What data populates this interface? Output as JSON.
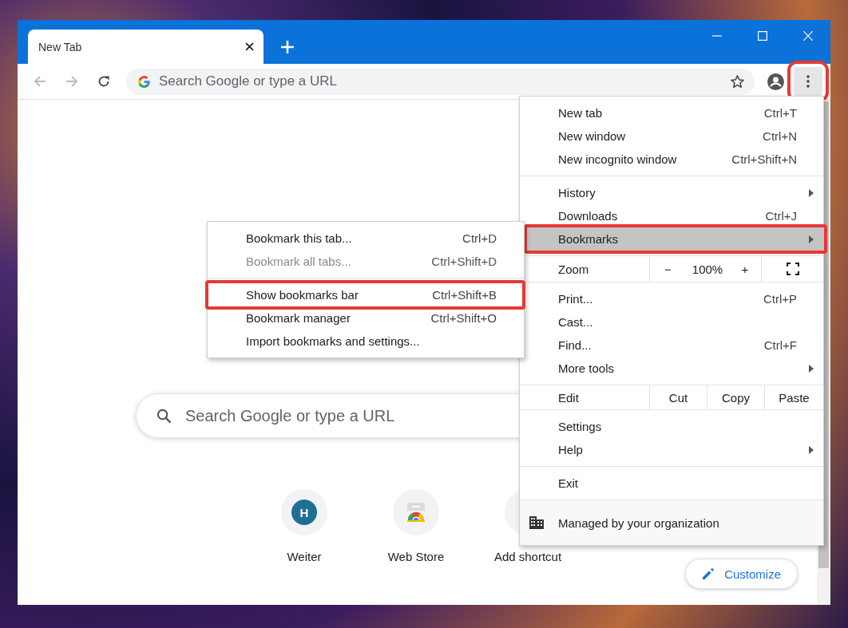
{
  "tabs": [
    {
      "title": "New Tab",
      "selected": true
    }
  ],
  "toolbar": {
    "omnibox": {
      "placeholder": "Search Google or type a URL"
    },
    "menu_button": {
      "highlighted": true
    }
  },
  "new_tab_page": {
    "search": {
      "placeholder": "Search Google or type a URL"
    },
    "shortcuts": [
      {
        "kind": "site",
        "label": "Weiter",
        "letter": "H"
      },
      {
        "kind": "store",
        "label": "Web Store"
      },
      {
        "kind": "add",
        "label": "Add shortcut"
      }
    ],
    "customize_button": "Customize"
  },
  "menu": {
    "sections": [
      {
        "items": [
          {
            "kind": "command",
            "label": "New tab",
            "shortcut": "Ctrl+T",
            "submenu": false,
            "selected": false,
            "highlighted": false
          },
          {
            "kind": "command",
            "label": "New window",
            "shortcut": "Ctrl+N",
            "submenu": false,
            "selected": false,
            "highlighted": false
          },
          {
            "kind": "command",
            "label": "New incognito window",
            "shortcut": "Ctrl+Shift+N",
            "submenu": false,
            "selected": false,
            "highlighted": false
          }
        ]
      },
      {
        "items": [
          {
            "kind": "command",
            "label": "History",
            "submenu": true,
            "selected": false,
            "highlighted": false
          },
          {
            "kind": "command",
            "label": "Downloads",
            "shortcut": "Ctrl+J",
            "submenu": false,
            "selected": false,
            "highlighted": false
          },
          {
            "kind": "command",
            "label": "Bookmarks",
            "submenu": true,
            "selected": true,
            "highlighted": true
          }
        ]
      },
      {
        "items": [
          {
            "kind": "zoom",
            "label": "Zoom",
            "minus": "−",
            "value": "100%",
            "plus": "+"
          }
        ]
      },
      {
        "items": [
          {
            "kind": "command",
            "label": "Print...",
            "shortcut": "Ctrl+P",
            "submenu": false,
            "selected": false,
            "highlighted": false
          },
          {
            "kind": "command",
            "label": "Cast...",
            "submenu": false,
            "selected": false,
            "highlighted": false
          },
          {
            "kind": "command",
            "label": "Find...",
            "shortcut": "Ctrl+F",
            "submenu": false,
            "selected": false,
            "highlighted": false
          },
          {
            "kind": "command",
            "label": "More tools",
            "submenu": true,
            "selected": false,
            "highlighted": false
          }
        ]
      },
      {
        "items": [
          {
            "kind": "edit",
            "label": "Edit",
            "actions": [
              "Cut",
              "Copy",
              "Paste"
            ]
          }
        ]
      },
      {
        "items": [
          {
            "kind": "command",
            "label": "Settings",
            "submenu": false,
            "selected": false,
            "highlighted": false
          },
          {
            "kind": "command",
            "label": "Help",
            "submenu": true,
            "selected": false,
            "highlighted": false
          }
        ]
      },
      {
        "items": [
          {
            "kind": "command",
            "label": "Exit",
            "submenu": false,
            "selected": false,
            "highlighted": false
          }
        ]
      },
      {
        "items": [
          {
            "kind": "managed",
            "label": "Managed by your organization"
          }
        ]
      }
    ]
  },
  "bookmarks_submenu": {
    "sections": [
      {
        "items": [
          {
            "label": "Bookmark this tab...",
            "shortcut": "Ctrl+D",
            "disabled": false,
            "selected": false,
            "highlighted": false
          },
          {
            "label": "Bookmark all tabs...",
            "shortcut": "Ctrl+Shift+D",
            "disabled": true,
            "selected": false,
            "highlighted": false
          }
        ]
      },
      {
        "items": [
          {
            "label": "Show bookmarks bar",
            "shortcut": "Ctrl+Shift+B",
            "disabled": false,
            "selected": false,
            "highlighted": true
          },
          {
            "label": "Bookmark manager",
            "shortcut": "Ctrl+Shift+O",
            "disabled": false,
            "selected": false,
            "highlighted": false
          },
          {
            "label": "Import bookmarks and settings...",
            "disabled": false,
            "selected": false,
            "highlighted": false
          }
        ]
      }
    ]
  }
}
